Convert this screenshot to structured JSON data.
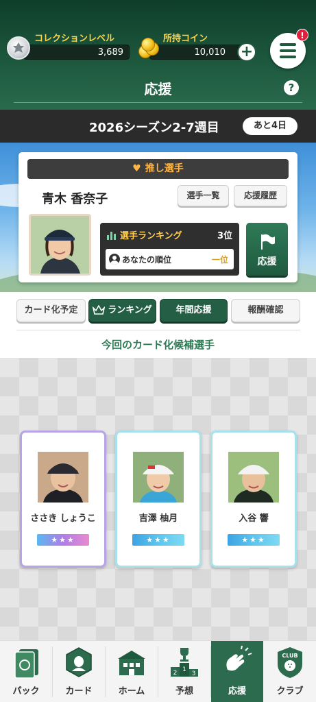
{
  "header": {
    "collection_level_label": "コレクションレベル",
    "collection_level_value": "3,689",
    "coins_label": "所持コイン",
    "coins_value": "10,010",
    "plus_label": "+",
    "notification_badge": "!",
    "page_title": "応援",
    "help_label": "?"
  },
  "season": {
    "title": "2026シーズン2-7週目",
    "days_left": "あと4日"
  },
  "favorite": {
    "header": "推し選手",
    "player_name": "青木 香奈子",
    "player_list_button": "選手一覧",
    "history_button": "応援履歴",
    "ranking_title": "選手ランキング",
    "ranking_value": "3位",
    "my_rank_label": "あなたの順位",
    "my_rank_value": "一位",
    "cheer_button": "応援"
  },
  "tabs": [
    {
      "label": "カード化予定",
      "active": false
    },
    {
      "label": "ランキング",
      "active": true
    },
    {
      "label": "年間応援",
      "active": true
    },
    {
      "label": "報酬確認",
      "active": false
    }
  ],
  "candidates": {
    "title": "今回のカード化候補選手",
    "players": [
      {
        "name": "ささき しょうこ",
        "stars": "★★★",
        "rarity_color": "#b9a3e8"
      },
      {
        "name": "吉澤 柚月",
        "stars": "★★★",
        "rarity_color": "#a6e2ec"
      },
      {
        "name": "入谷 響",
        "stars": "★★★",
        "rarity_color": "#a6e2ec"
      }
    ]
  },
  "bottom_nav": [
    {
      "label": "パック",
      "icon": "pack-icon",
      "active": false
    },
    {
      "label": "カード",
      "icon": "card-icon",
      "active": false
    },
    {
      "label": "ホーム",
      "icon": "home-icon",
      "active": false
    },
    {
      "label": "予想",
      "icon": "podium-icon",
      "active": false
    },
    {
      "label": "応援",
      "icon": "cheer-hands-icon",
      "active": true
    },
    {
      "label": "クラブ",
      "icon": "club-icon",
      "active": false
    }
  ],
  "club_badge_text": "CLUB",
  "podium_numbers": [
    "2",
    "1",
    "3"
  ],
  "colors": {
    "brand_green": "#1f5a3e",
    "accent_gold": "#ffd54a",
    "alert_red": "#e0203c"
  }
}
